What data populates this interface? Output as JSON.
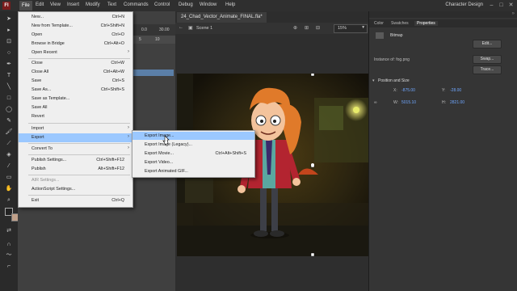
{
  "menubar": {
    "logo": "Fl",
    "items": [
      "File",
      "Edit",
      "View",
      "Insert",
      "Modify",
      "Text",
      "Commands",
      "Control",
      "Debug",
      "Window",
      "Help"
    ],
    "workspace": "Character Design",
    "window_buttons": [
      "–",
      "□",
      "✕"
    ]
  },
  "document": {
    "tab_title": "24_Chad_Vector_Animate_FINAL.fla*",
    "scene": "Scene 1",
    "zoom": "15%"
  },
  "timeline": {
    "frame_label": "0.0",
    "fps": "30.00",
    "ruler_numbers": [
      "5",
      "10"
    ]
  },
  "file_menu": {
    "items": [
      {
        "label": "New...",
        "shortcut": "Ctrl+N"
      },
      {
        "label": "New from Template...",
        "shortcut": "Ctrl+Shift+N"
      },
      {
        "label": "Open",
        "shortcut": "Ctrl+O"
      },
      {
        "label": "Browse in Bridge",
        "shortcut": "Ctrl+Alt+O"
      },
      {
        "label": "Open Recent",
        "shortcut": ""
      },
      {
        "label": "Close",
        "shortcut": "Ctrl+W"
      },
      {
        "label": "Close All",
        "shortcut": "Ctrl+Alt+W"
      },
      {
        "label": "Save",
        "shortcut": "Ctrl+S"
      },
      {
        "label": "Save As...",
        "shortcut": "Ctrl+Shift+S"
      },
      {
        "label": "Save as Template...",
        "shortcut": ""
      },
      {
        "label": "Save All",
        "shortcut": ""
      },
      {
        "label": "Revert",
        "shortcut": ""
      },
      {
        "label": "Import",
        "shortcut": ""
      },
      {
        "label": "Export",
        "shortcut": ""
      },
      {
        "label": "Convert To",
        "shortcut": ""
      },
      {
        "label": "Publish Settings...",
        "shortcut": "Ctrl+Shift+F12"
      },
      {
        "label": "Publish",
        "shortcut": "Alt+Shift+F12"
      },
      {
        "label": "AIR Settings...",
        "shortcut": ""
      },
      {
        "label": "ActionScript Settings...",
        "shortcut": ""
      },
      {
        "label": "Exit",
        "shortcut": "Ctrl+Q"
      }
    ]
  },
  "export_menu": {
    "items": [
      {
        "label": "Export Image...",
        "shortcut": ""
      },
      {
        "label": "Export Image (Legacy)...",
        "shortcut": ""
      },
      {
        "label": "Export Movie...",
        "shortcut": "Ctrl+Alt+Shift+S"
      },
      {
        "label": "Export Video...",
        "shortcut": ""
      },
      {
        "label": "Export Animated GIF...",
        "shortcut": ""
      }
    ]
  },
  "properties": {
    "tabs": [
      "Color",
      "Swatches",
      "Properties"
    ],
    "type": "Bitmap",
    "edit_label": "Edit...",
    "instance_of_label": "Instance of: fog.png",
    "swap_label": "Swap...",
    "trace_label": "Trace...",
    "section": "Position and Size",
    "x_label": "X:",
    "x_value": "-875.00",
    "y_label": "Y:",
    "y_value": "-28.00",
    "w_label": "W:",
    "w_value": "5015.10",
    "h_label": "H:",
    "h_value": "2821.00"
  },
  "colors": {
    "menu_highlight": "#9bc8ff",
    "value_blue": "#6fa7ff",
    "ui_dark": "#2f2f2f"
  }
}
